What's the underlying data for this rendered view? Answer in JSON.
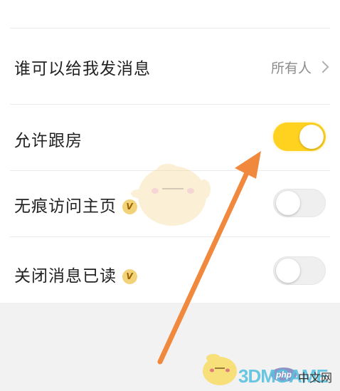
{
  "rows": [
    {
      "label": "谁可以给我发消息",
      "value": "所有人"
    },
    {
      "label": "允许跟房",
      "toggle": "on"
    },
    {
      "label": "无痕访问主页",
      "badge": "V",
      "toggle": "off"
    },
    {
      "label": "关闭消息已读",
      "badge": "V",
      "toggle": "off"
    }
  ],
  "colors": {
    "toggle_on": "#ffd21f",
    "arrow": "#f0883e",
    "badge": "#f3d37a"
  },
  "watermarks": {
    "php_label": "php",
    "php_site": "中文网",
    "brand": "3DMGAME"
  }
}
